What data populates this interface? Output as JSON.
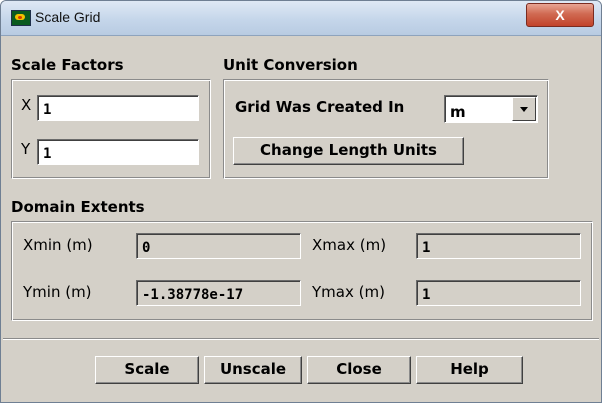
{
  "window": {
    "title": "Scale Grid",
    "close_label": "X"
  },
  "scale_factors": {
    "title": "Scale Factors",
    "x_label": "X",
    "x_value": "1",
    "y_label": "Y",
    "y_value": "1"
  },
  "unit_conversion": {
    "title": "Unit Conversion",
    "grid_created_in_label": "Grid Was Created In",
    "unit_value": "m",
    "change_units_label": "Change Length Units"
  },
  "domain_extents": {
    "title": "Domain Extents",
    "xmin_label": "Xmin (m)",
    "xmin_value": "0",
    "xmax_label": "Xmax (m)",
    "xmax_value": "1",
    "ymin_label": "Ymin (m)",
    "ymin_value": "-1.38778e-17",
    "ymax_label": "Ymax (m)",
    "ymax_value": "1"
  },
  "buttons": {
    "scale": "Scale",
    "unscale": "Unscale",
    "close": "Close",
    "help": "Help"
  },
  "colors": {
    "dialog_bg": "#d4d0c8",
    "close_button": "#c2432b"
  }
}
